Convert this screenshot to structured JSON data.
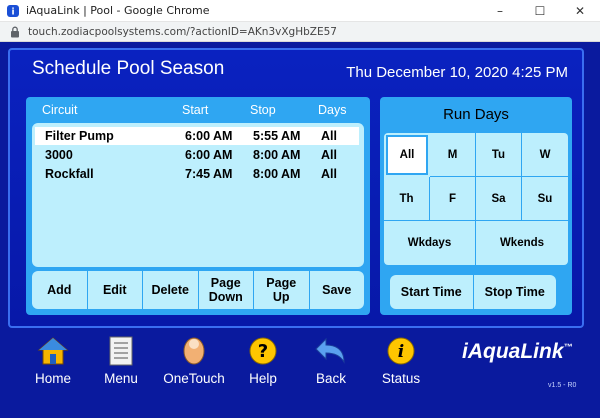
{
  "window": {
    "title": "iAquaLink | Pool - Google Chrome",
    "url": "touch.zodiacpoolsystems.com/?actionID=AKn3vXgHbZE57",
    "controls": {
      "minimize": "–",
      "maximize": "☐",
      "close": "✕"
    }
  },
  "header": {
    "title": "Schedule Pool Season",
    "datetime": "Thu December 10, 2020 4:25 PM"
  },
  "schedule": {
    "columns": {
      "circuit": "Circuit",
      "start": "Start",
      "stop": "Stop",
      "days": "Days"
    },
    "rows": [
      {
        "circuit": "Filter Pump",
        "start": "6:00 AM",
        "stop": "5:55 AM",
        "days": "All"
      },
      {
        "circuit": "3000",
        "start": "6:00 AM",
        "stop": "8:00 AM",
        "days": "All"
      },
      {
        "circuit": "Rockfall",
        "start": "7:45 AM",
        "stop": "8:00 AM",
        "days": "All"
      }
    ],
    "buttons": {
      "add": "Add",
      "edit": "Edit",
      "delete": "Delete",
      "page_down_1": "Page",
      "page_down_2": "Down",
      "page_up_1": "Page",
      "page_up_2": "Up",
      "save": "Save"
    }
  },
  "run_days": {
    "title": "Run Days",
    "days": {
      "all": "All",
      "m": "M",
      "tu": "Tu",
      "w": "W",
      "th": "Th",
      "f": "F",
      "sa": "Sa",
      "su": "Su",
      "wkdays": "Wkdays",
      "wkends": "Wkends"
    },
    "start_time": "Start Time",
    "stop_time": "Stop Time"
  },
  "nav": {
    "home": "Home",
    "menu": "Menu",
    "onetouch": "OneTouch",
    "help": "Help",
    "back": "Back",
    "status": "Status"
  },
  "brand": "iAquaLink",
  "brand_tm": "™",
  "version": "v1.5 - R0",
  "colors": {
    "background": "#0a1a9e",
    "panel": "#2fa6f2",
    "list": "#bdeffd"
  }
}
